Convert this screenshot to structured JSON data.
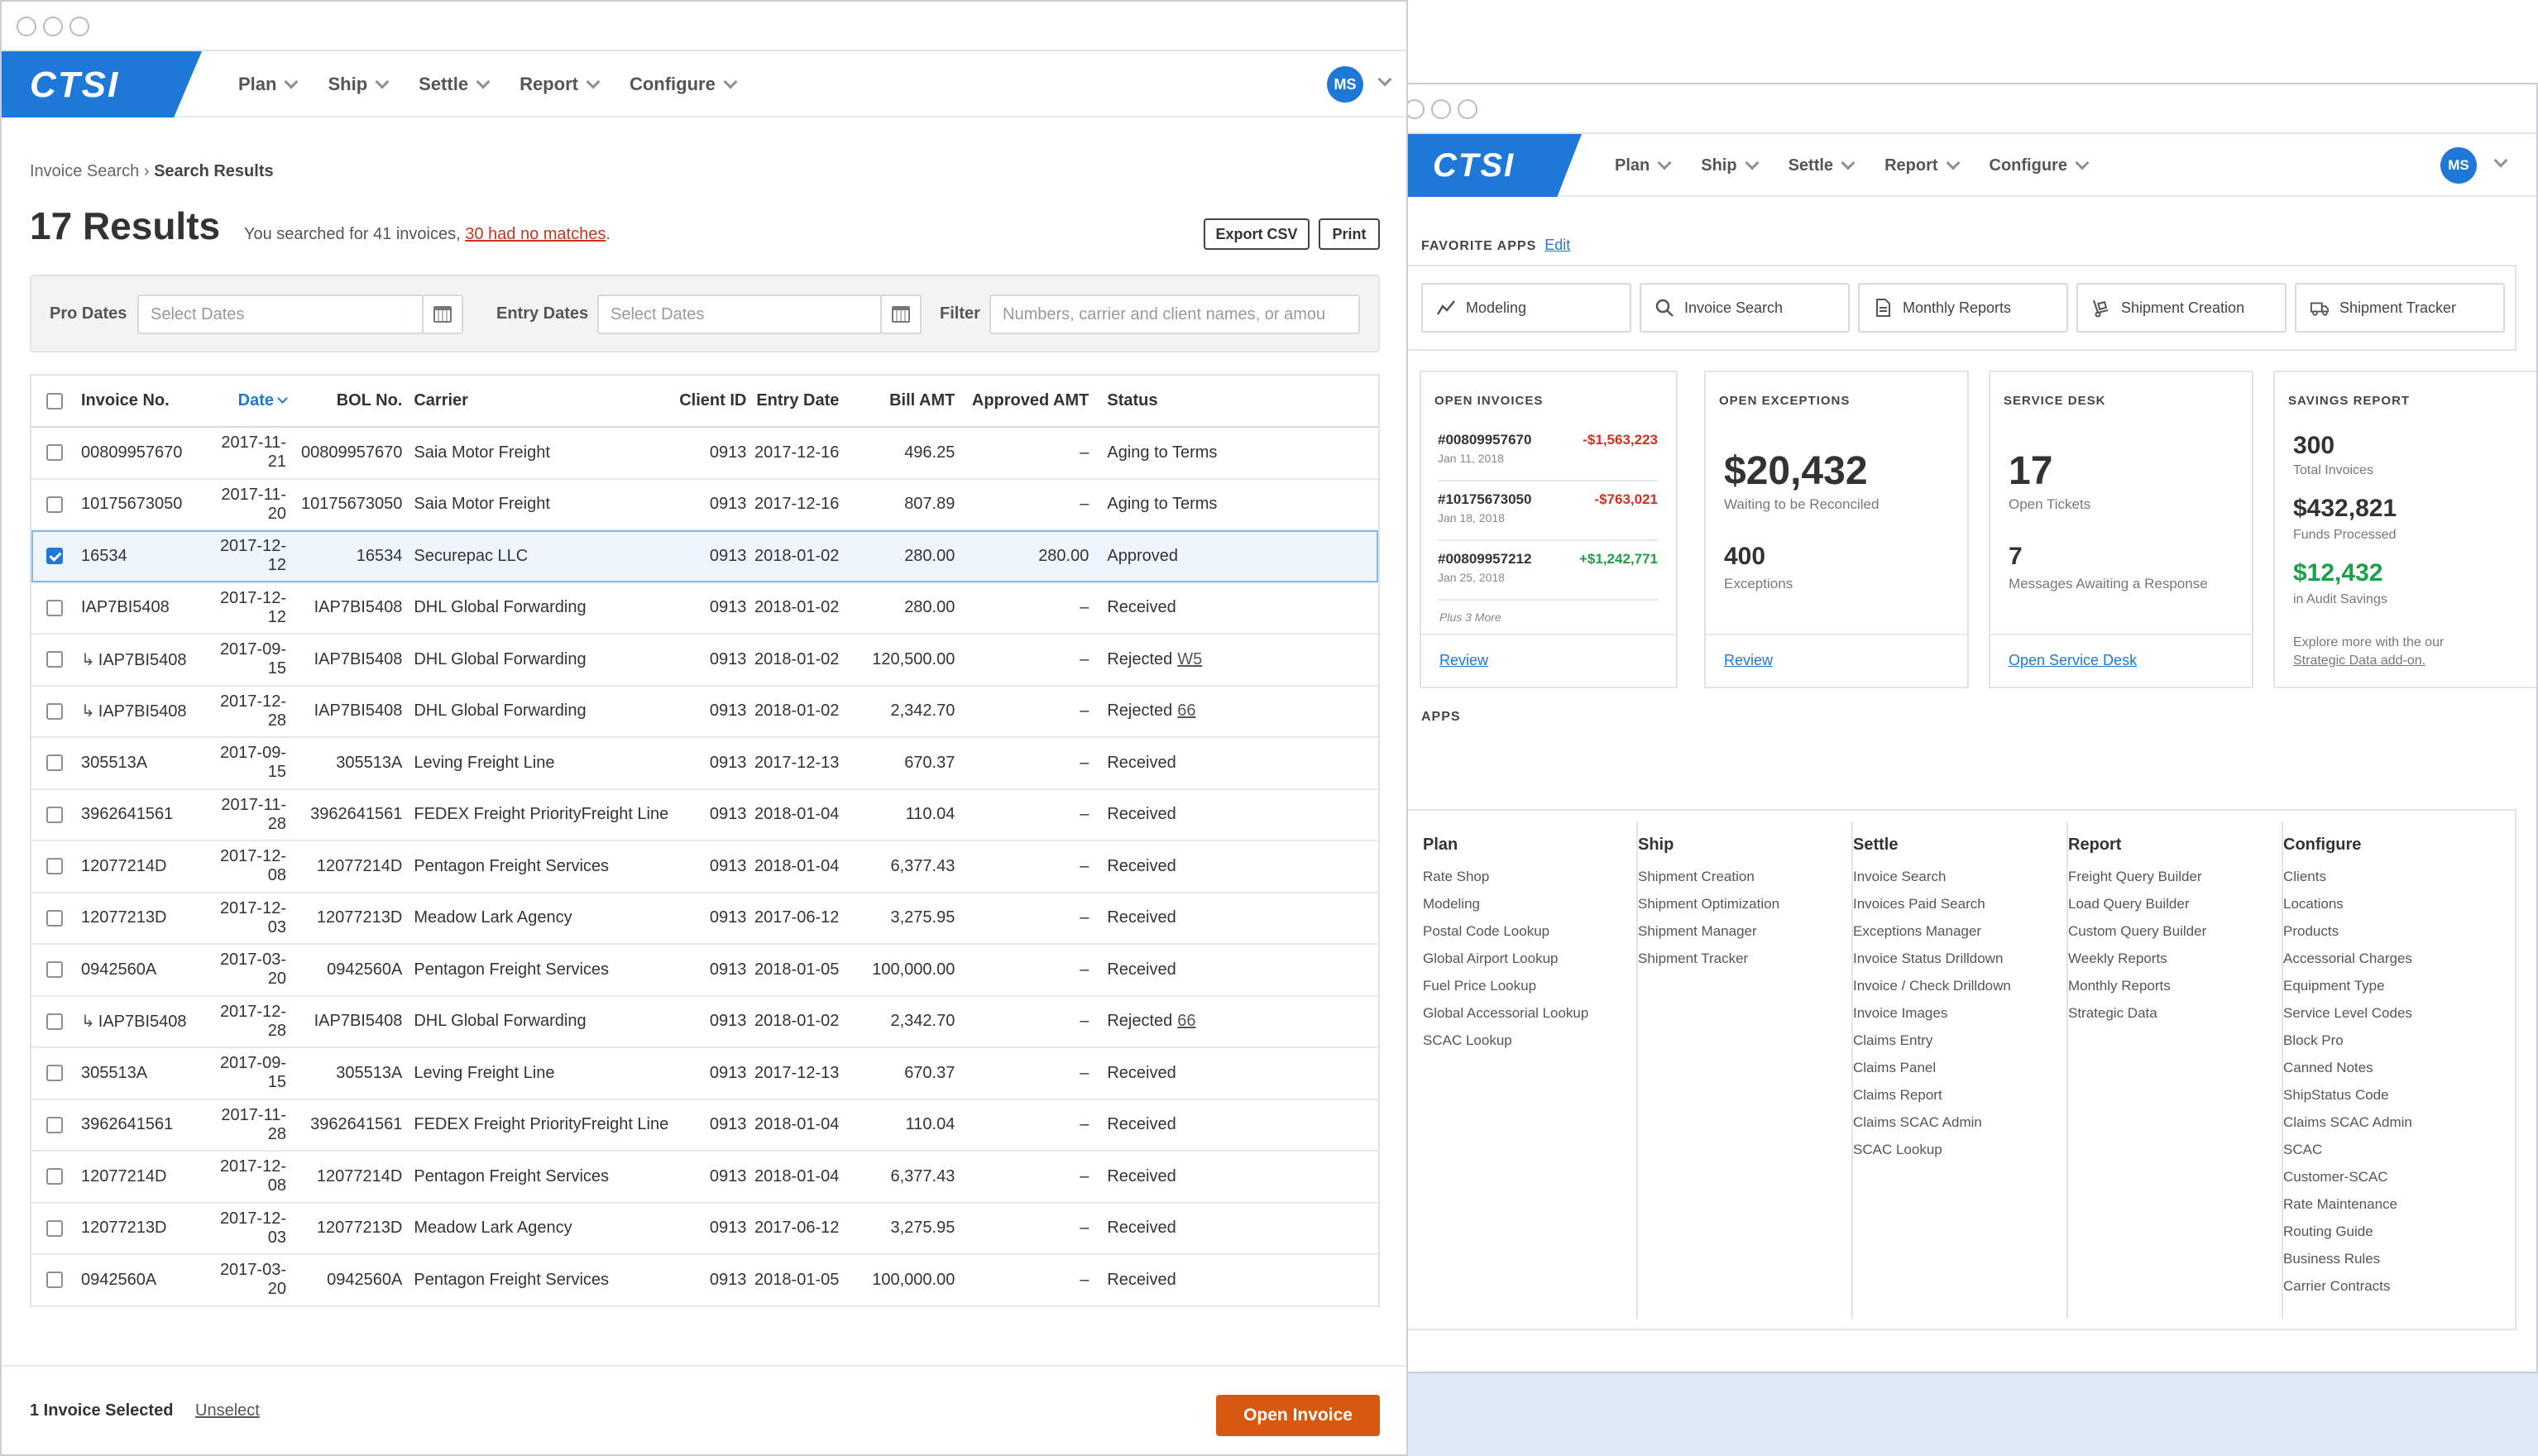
{
  "nav": {
    "logo": "CTSI",
    "items": [
      "Plan",
      "Ship",
      "Settle",
      "Report",
      "Configure"
    ],
    "avatar": "MS"
  },
  "left": {
    "breadcrumb_parent": "Invoice Search",
    "breadcrumb_sep": "›",
    "breadcrumb_current": "Search Results",
    "results_title": "17 Results",
    "results_sub_prefix": "You searched for 41 invoices, ",
    "results_sub_link": "30 had no matches",
    "results_sub_suffix": ".",
    "export_label": "Export CSV",
    "print_label": "Print",
    "filters": {
      "pro_label": "Pro Dates",
      "pro_placeholder": "Select Dates",
      "entry_label": "Entry Dates",
      "entry_placeholder": "Select Dates",
      "filter_label": "Filter",
      "filter_placeholder": "Numbers, carrier and client names, or amou"
    },
    "columns": [
      "Invoice No.",
      "Date",
      "BOL No.",
      "Carrier",
      "Client ID",
      "Entry Date",
      "Bill AMT",
      "Approved AMT",
      "Status"
    ],
    "rows": [
      {
        "inv": "00809957670",
        "child": false,
        "date": "2017-11-21",
        "bol": "00809957670",
        "carrier": "Saia Motor Freight",
        "client": "0913",
        "entry": "2017-12-16",
        "bill": "496.25",
        "approved": "–",
        "status": "Aging to Terms",
        "ref": "",
        "checked": false
      },
      {
        "inv": "10175673050",
        "child": false,
        "date": "2017-11-20",
        "bol": "10175673050",
        "carrier": "Saia Motor Freight",
        "client": "0913",
        "entry": "2017-12-16",
        "bill": "807.89",
        "approved": "–",
        "status": "Aging to Terms",
        "ref": "",
        "checked": false
      },
      {
        "inv": "16534",
        "child": false,
        "date": "2017-12-12",
        "bol": "16534",
        "carrier": "Securepac LLC",
        "client": "0913",
        "entry": "2018-01-02",
        "bill": "280.00",
        "approved": "280.00",
        "status": "Approved",
        "ref": "",
        "checked": true
      },
      {
        "inv": "IAP7BI5408",
        "child": false,
        "date": "2017-12-12",
        "bol": "IAP7BI5408",
        "carrier": "DHL Global Forwarding",
        "client": "0913",
        "entry": "2018-01-02",
        "bill": "280.00",
        "approved": "–",
        "status": "Received",
        "ref": "",
        "checked": false
      },
      {
        "inv": "IAP7BI5408",
        "child": true,
        "date": "2017-09-15",
        "bol": "IAP7BI5408",
        "carrier": "DHL Global Forwarding",
        "client": "0913",
        "entry": "2018-01-02",
        "bill": "120,500.00",
        "approved": "–",
        "status": "Rejected",
        "ref": "W5",
        "checked": false
      },
      {
        "inv": "IAP7BI5408",
        "child": true,
        "date": "2017-12-28",
        "bol": "IAP7BI5408",
        "carrier": "DHL Global Forwarding",
        "client": "0913",
        "entry": "2018-01-02",
        "bill": "2,342.70",
        "approved": "–",
        "status": "Rejected",
        "ref": "66",
        "checked": false
      },
      {
        "inv": "305513A",
        "child": false,
        "date": "2017-09-15",
        "bol": "305513A",
        "carrier": "Leving Freight Line",
        "client": "0913",
        "entry": "2017-12-13",
        "bill": "670.37",
        "approved": "–",
        "status": "Received",
        "ref": "",
        "checked": false
      },
      {
        "inv": "3962641561",
        "child": false,
        "date": "2017-11-28",
        "bol": "3962641561",
        "carrier": "FEDEX Freight PriorityFreight Line",
        "client": "0913",
        "entry": "2018-01-04",
        "bill": "110.04",
        "approved": "–",
        "status": "Received",
        "ref": "",
        "checked": false
      },
      {
        "inv": "12077214D",
        "child": false,
        "date": "2017-12-08",
        "bol": "12077214D",
        "carrier": "Pentagon Freight Services",
        "client": "0913",
        "entry": "2018-01-04",
        "bill": "6,377.43",
        "approved": "–",
        "status": "Received",
        "ref": "",
        "checked": false
      },
      {
        "inv": "12077213D",
        "child": false,
        "date": "2017-12-03",
        "bol": "12077213D",
        "carrier": "Meadow Lark Agency",
        "client": "0913",
        "entry": "2017-06-12",
        "bill": "3,275.95",
        "approved": "–",
        "status": "Received",
        "ref": "",
        "checked": false
      },
      {
        "inv": "0942560A",
        "child": false,
        "date": "2017-03-20",
        "bol": "0942560A",
        "carrier": "Pentagon Freight Services",
        "client": "0913",
        "entry": "2018-01-05",
        "bill": "100,000.00",
        "approved": "–",
        "status": "Received",
        "ref": "",
        "checked": false
      },
      {
        "inv": "IAP7BI5408",
        "child": true,
        "date": "2017-12-28",
        "bol": "IAP7BI5408",
        "carrier": "DHL Global Forwarding",
        "client": "0913",
        "entry": "2018-01-02",
        "bill": "2,342.70",
        "approved": "–",
        "status": "Rejected",
        "ref": "66",
        "checked": false
      },
      {
        "inv": "305513A",
        "child": false,
        "date": "2017-09-15",
        "bol": "305513A",
        "carrier": "Leving Freight Line",
        "client": "0913",
        "entry": "2017-12-13",
        "bill": "670.37",
        "approved": "–",
        "status": "Received",
        "ref": "",
        "checked": false
      },
      {
        "inv": "3962641561",
        "child": false,
        "date": "2017-11-28",
        "bol": "3962641561",
        "carrier": "FEDEX Freight PriorityFreight Line",
        "client": "0913",
        "entry": "2018-01-04",
        "bill": "110.04",
        "approved": "–",
        "status": "Received",
        "ref": "",
        "checked": false
      },
      {
        "inv": "12077214D",
        "child": false,
        "date": "2017-12-08",
        "bol": "12077214D",
        "carrier": "Pentagon Freight Services",
        "client": "0913",
        "entry": "2018-01-04",
        "bill": "6,377.43",
        "approved": "–",
        "status": "Received",
        "ref": "",
        "checked": false
      },
      {
        "inv": "12077213D",
        "child": false,
        "date": "2017-12-03",
        "bol": "12077213D",
        "carrier": "Meadow Lark Agency",
        "client": "0913",
        "entry": "2017-06-12",
        "bill": "3,275.95",
        "approved": "–",
        "status": "Received",
        "ref": "",
        "checked": false
      },
      {
        "inv": "0942560A",
        "child": false,
        "date": "2017-03-20",
        "bol": "0942560A",
        "carrier": "Pentagon Freight Services",
        "client": "0913",
        "entry": "2018-01-05",
        "bill": "100,000.00",
        "approved": "–",
        "status": "Received",
        "ref": "",
        "checked": false
      }
    ],
    "footer_selected": "1 Invoice Selected",
    "footer_unselect": "Unselect",
    "open_invoice": "Open Invoice"
  },
  "right": {
    "favorites_label": "FAVORITE APPS",
    "favorites_edit": "Edit",
    "favorites": [
      {
        "label": "Modeling",
        "icon": "chart-line-icon"
      },
      {
        "label": "Invoice Search",
        "icon": "search-icon"
      },
      {
        "label": "Monthly Reports",
        "icon": "document-icon"
      },
      {
        "label": "Shipment Creation",
        "icon": "hand-truck-icon"
      },
      {
        "label": "Shipment Tracker",
        "icon": "truck-icon"
      }
    ],
    "open_invoices": {
      "title": "OPEN INVOICES",
      "items": [
        {
          "num": "#00809957670",
          "date": "Jan 11, 2018",
          "amount": "-$1,563,223",
          "sign": "neg"
        },
        {
          "num": "#10175673050",
          "date": "Jan 18, 2018",
          "amount": "-$763,021",
          "sign": "neg"
        },
        {
          "num": "#00809957212",
          "date": "Jan 25, 2018",
          "amount": "+$1,242,771",
          "sign": "pos"
        }
      ],
      "more": "Plus 3 More",
      "link": "Review"
    },
    "open_exceptions": {
      "title": "OPEN EXCEPTIONS",
      "amount": "$20,432",
      "amount_label": "Waiting to be Reconciled",
      "count": "400",
      "count_label": "Exceptions",
      "link": "Review"
    },
    "service_desk": {
      "title": "SERVICE DESK",
      "tickets": "17",
      "tickets_label": "Open Tickets",
      "messages": "7",
      "messages_label": "Messages Awaiting a Response",
      "link": "Open Service Desk"
    },
    "savings": {
      "title": "SAVINGS REPORT",
      "invoices": "300",
      "invoices_label": "Total Invoices",
      "funds": "$432,821",
      "funds_label": "Funds Processed",
      "savings": "$12,432",
      "savings_label": "in Audit Savings",
      "explore": "Explore more with the our",
      "explore_link": "Strategic Data add-on."
    },
    "apps_label": "APPS",
    "apps": [
      {
        "head": "Plan",
        "items": [
          "Rate Shop",
          "Modeling",
          "Postal Code Lookup",
          "Global Airport Lookup",
          "Fuel Price Lookup",
          "Global Accessorial Lookup",
          "SCAC Lookup"
        ]
      },
      {
        "head": "Ship",
        "items": [
          "Shipment Creation",
          "Shipment Optimization",
          "Shipment Manager",
          "Shipment Tracker"
        ]
      },
      {
        "head": "Settle",
        "items": [
          "Invoice Search",
          "Invoices Paid Search",
          "Exceptions Manager",
          "Invoice Status Drilldown",
          "Invoice / Check Drilldown",
          "Invoice Images",
          "Claims Entry",
          "Claims Panel",
          "Claims Report",
          "Claims SCAC Admin",
          "SCAC Lookup"
        ]
      },
      {
        "head": "Report",
        "items": [
          "Freight Query Builder",
          "Load Query Builder",
          "Custom Query Builder",
          "Weekly Reports",
          "Monthly Reports",
          "Strategic Data"
        ]
      },
      {
        "head": "Configure",
        "items": [
          "Clients",
          "Locations",
          "Products",
          "Accessorial Charges",
          "Equipment Type",
          "Service Level Codes",
          "Block Pro",
          "Canned Notes",
          "ShipStatus Code",
          "Claims SCAC Admin",
          "SCAC",
          "Customer-SCAC",
          "Rate Maintenance",
          "Routing Guide",
          "Business Rules",
          "Carrier Contracts"
        ]
      }
    ]
  }
}
